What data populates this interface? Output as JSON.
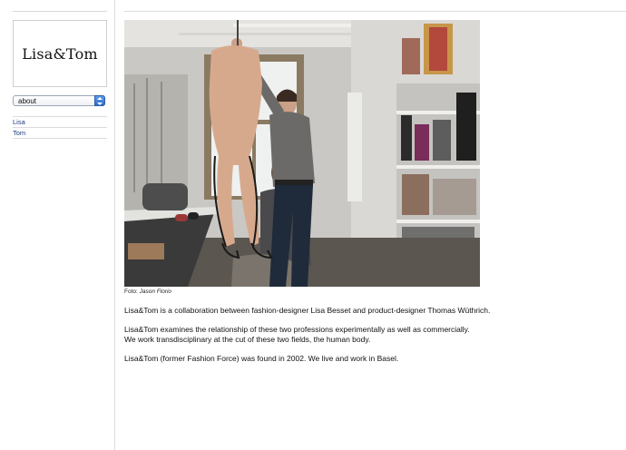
{
  "brand": {
    "logo_text": "Lisa&Tom"
  },
  "nav": {
    "select_value": "about",
    "items": [
      {
        "label": "Lisa"
      },
      {
        "label": "Tom"
      }
    ]
  },
  "main": {
    "caption_prefix": "Foto:",
    "caption_author": "Jason Florio",
    "paragraphs": [
      "Lisa&Tom is a collaboration between fashion-designer Lisa Besset and product-designer Thomas Wüthrich.",
      "Lisa&Tom examines the relationship of these two professions experimentally as well as commercially.",
      "We work transdisciplinary at the cut of these two fields, the human body.",
      "Lisa&Tom (former Fashion Force) was found in 2002. We live and work in Basel."
    ]
  }
}
